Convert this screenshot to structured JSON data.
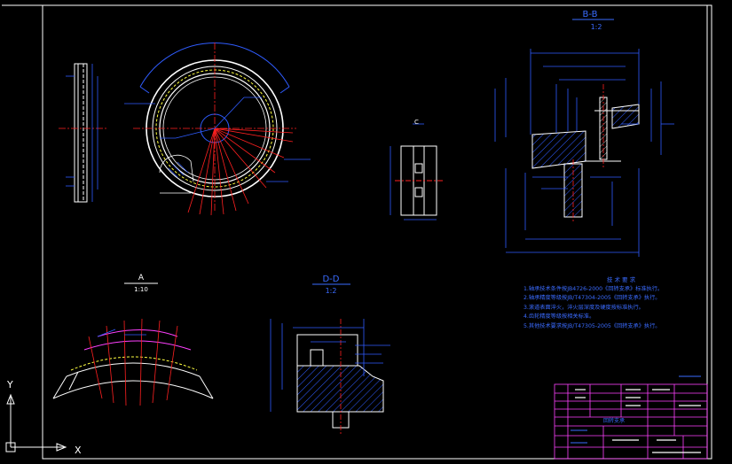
{
  "drawing": {
    "background": "#000000",
    "colors": {
      "frame": "#ffffff",
      "outline": "#ffffff",
      "dimension": "#2f5cff",
      "centerline": "#ff2020",
      "hatch": "#2f5cff",
      "title_block": "#ff40ff",
      "note_text": "#3a6bff",
      "thread": "#ffff40"
    },
    "views": {
      "section_bb": {
        "title": "B-B",
        "scale": "1:2"
      },
      "detail_a": {
        "title": "A",
        "scale": "1:10"
      },
      "section_dd": {
        "title": "D-D",
        "scale": "1:2"
      },
      "small_view_label": "C"
    },
    "technical_requirements": {
      "heading": "技 术 要 求",
      "items": [
        "1.轴承技术条件按JB4726-2000《回转支承》标准执行。",
        "2.轴承精度等级按JB/T47304-2005《回转支承》执行。",
        "3.滚道表面淬火，淬火层深度及硬度按标准执行。",
        "4.齿轮精度等级按相关标准。",
        "5.其他技术要求按JB/T47305-2005《回转支承》执行。"
      ]
    },
    "title_block": {
      "part_name": "回转支承"
    },
    "ucs": {
      "x_label": "X",
      "y_label": "Y"
    }
  }
}
